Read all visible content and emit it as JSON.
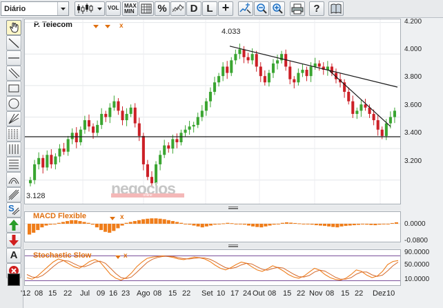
{
  "toolbar": {
    "period": "Diário",
    "vol_label": "VOL",
    "maxmin_line1": "MAX",
    "maxmin_line2": "MIN",
    "percent_label": "%",
    "d_label": "D",
    "l_label": "L",
    "plus_label": "+",
    "help_label": "?"
  },
  "tools": {
    "s_label": "S",
    "text_label": "A"
  },
  "chart": {
    "ticker": "P. Telecom",
    "close_marker": "x",
    "high_label": "4.033",
    "low_label": "3.128",
    "watermark": "negocios",
    "watermark_sub": "online",
    "price_axis": [
      "4.200",
      "4.000",
      "3.800",
      "3.600",
      "3.400",
      "3.200"
    ],
    "macd_label": "MACD Flexible",
    "macd_axis": [
      "0.0000",
      "-0.0800"
    ],
    "stoch_label": "Stochastic Slow",
    "stoch_axis": [
      "90.0000",
      "50.0000",
      "10.0000"
    ],
    "x_labels": [
      "'12",
      "08",
      "15",
      "22",
      "Jul",
      "09",
      "16",
      "23",
      "Ago",
      "08",
      "15",
      "22",
      "Set",
      "10",
      "17",
      "24",
      "Out",
      "08",
      "15",
      "22",
      "Nov",
      "08",
      "15",
      "22",
      "Dez",
      "10"
    ],
    "colors": {
      "up": "#3aa531",
      "down": "#cc2027",
      "indicator": "#ef7d1a",
      "line": "#1a1a1a"
    }
  },
  "chart_data": {
    "type": "candlestick",
    "ticker": "P. Telecom",
    "ylim": [
      3.05,
      4.22
    ],
    "support_level": 3.475,
    "trendline": [
      [
        3.995,
        4.05
      ],
      [
        3.79
      ]
    ],
    "close": [
      3.2,
      3.3,
      3.34,
      3.28,
      3.36,
      3.3,
      3.35,
      3.4,
      3.38,
      3.46,
      3.5,
      3.44,
      3.52,
      3.58,
      3.54,
      3.5,
      3.55,
      3.62,
      3.6,
      3.66,
      3.7,
      3.64,
      3.58,
      3.62,
      3.66,
      3.56,
      3.48,
      3.3,
      3.22,
      3.18,
      3.3,
      3.36,
      3.42,
      3.4,
      3.46,
      3.44,
      3.5,
      3.52,
      3.54,
      3.55,
      3.6,
      3.64,
      3.7,
      3.76,
      3.82,
      3.86,
      3.92,
      3.88,
      3.96,
      4.0,
      4.03,
      3.98,
      3.96,
      4.0,
      3.92,
      3.86,
      3.82,
      3.88,
      3.94,
      3.96,
      4.0,
      3.92,
      3.84,
      3.82,
      3.88,
      3.9,
      3.86,
      3.92,
      3.94,
      3.92,
      3.9,
      3.92,
      3.88,
      3.84,
      3.82,
      3.76,
      3.7,
      3.62,
      3.64,
      3.68,
      3.66,
      3.62,
      3.58,
      3.52,
      3.48,
      3.56,
      3.6,
      3.64
    ],
    "macd": [
      -0.06,
      -0.05,
      -0.035,
      -0.02,
      -0.01,
      -0.005,
      0.0,
      0.005,
      0.01,
      0.015,
      0.02,
      0.02,
      0.015,
      0.01,
      0.005,
      -0.005,
      -0.02,
      -0.035,
      -0.045,
      -0.05,
      -0.04,
      -0.025,
      -0.01,
      0.005,
      0.01,
      0.015,
      0.02,
      0.025,
      0.028,
      0.03,
      0.03,
      0.028,
      0.025,
      0.02,
      0.015,
      0.01,
      0.005,
      0.0,
      -0.005,
      -0.01,
      -0.015,
      -0.02,
      -0.015,
      -0.01,
      -0.005,
      0.0,
      0.002,
      0.005,
      0.003,
      0.0,
      -0.003,
      -0.005,
      -0.01,
      -0.015,
      -0.018,
      -0.02,
      -0.015,
      -0.01,
      -0.005,
      0.0,
      0.005,
      0.008,
      0.006,
      0.004,
      0.002,
      0.0,
      -0.002,
      -0.005,
      -0.008,
      -0.01,
      -0.012,
      -0.015,
      -0.018,
      -0.02,
      -0.015,
      -0.012,
      -0.01,
      -0.008,
      -0.006,
      -0.004,
      -0.005,
      -0.007,
      -0.008,
      -0.005,
      -0.002,
      0.0,
      0.004,
      0.008
    ],
    "stoch_k": [
      20,
      15,
      25,
      40,
      55,
      70,
      80,
      75,
      65,
      55,
      50,
      60,
      72,
      78,
      70,
      50,
      30,
      18,
      12,
      20,
      35,
      55,
      70,
      82,
      86,
      88,
      90,
      88,
      85,
      80,
      78,
      82,
      86,
      84,
      80,
      72,
      60,
      50,
      45,
      52,
      62,
      70,
      66,
      55,
      45,
      40,
      48,
      58,
      52,
      42,
      30,
      22,
      18,
      25,
      38,
      50,
      44,
      30,
      20,
      14,
      12,
      18,
      30,
      45,
      40,
      28,
      20,
      25,
      40,
      62,
      72,
      75
    ],
    "stoch_d": [
      30,
      22,
      20,
      27,
      40,
      55,
      68,
      75,
      73,
      65,
      57,
      55,
      61,
      70,
      73,
      66,
      50,
      33,
      20,
      17,
      22,
      37,
      53,
      69,
      79,
      85,
      88,
      89,
      88,
      84,
      81,
      80,
      82,
      84,
      83,
      79,
      71,
      61,
      52,
      49,
      53,
      61,
      66,
      64,
      55,
      47,
      44,
      49,
      53,
      51,
      41,
      31,
      23,
      22,
      27,
      38,
      44,
      41,
      31,
      21,
      15,
      15,
      20,
      31,
      38,
      38,
      29,
      24,
      28,
      42,
      58,
      70
    ]
  }
}
